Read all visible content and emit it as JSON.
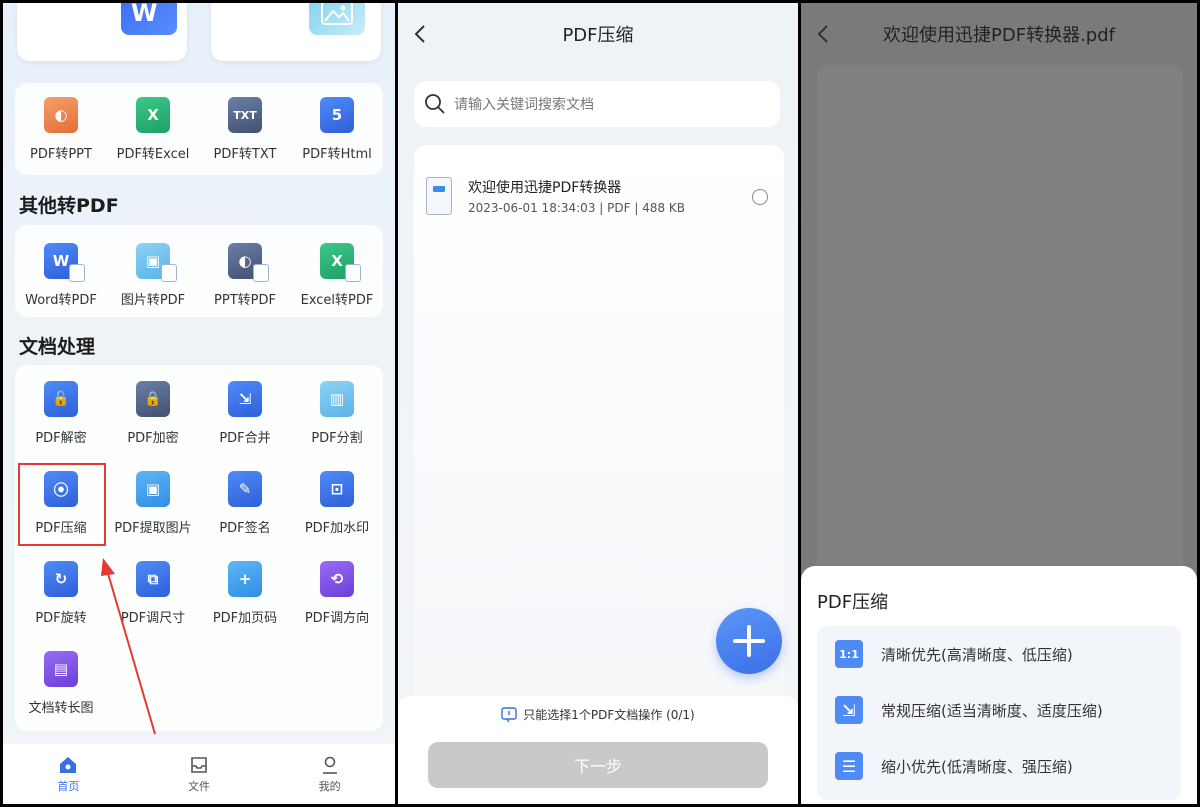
{
  "panel1": {
    "top_cards": [
      {
        "icon": "word-icon",
        "glyph": "W"
      },
      {
        "icon": "image-icon"
      }
    ],
    "pdf_convert_row": [
      {
        "label": "PDF转PPT",
        "icon": "ppt-icon",
        "glyph": "◐"
      },
      {
        "label": "PDF转Excel",
        "icon": "excel-icon",
        "glyph": "X"
      },
      {
        "label": "PDF转TXT",
        "icon": "txt-icon",
        "glyph": "TXT"
      },
      {
        "label": "PDF转Html",
        "icon": "html-icon",
        "glyph": "5"
      }
    ],
    "section_other": "其他转PDF",
    "other_row": [
      {
        "label": "Word转PDF",
        "icon": "word-icon",
        "glyph": "W"
      },
      {
        "label": "图片转PDF",
        "icon": "image-icon",
        "glyph": "▣"
      },
      {
        "label": "PPT转PDF",
        "icon": "ppt-icon",
        "glyph": "◐"
      },
      {
        "label": "Excel转PDF",
        "icon": "excel-icon",
        "glyph": "X"
      }
    ],
    "section_doc": "文档处理",
    "doc_items": [
      {
        "label": "PDF解密",
        "icon": "unlock-icon",
        "glyph": "🔓"
      },
      {
        "label": "PDF加密",
        "icon": "lock-icon",
        "glyph": "🔒"
      },
      {
        "label": "PDF合并",
        "icon": "merge-icon",
        "glyph": "⇲"
      },
      {
        "label": "PDF分割",
        "icon": "split-icon",
        "glyph": "▥"
      },
      {
        "label": "PDF压缩",
        "icon": "compress-icon",
        "glyph": "⦿"
      },
      {
        "label": "PDF提取图片",
        "icon": "extract-image-icon",
        "glyph": "▣"
      },
      {
        "label": "PDF签名",
        "icon": "signature-icon",
        "glyph": "✎"
      },
      {
        "label": "PDF加水印",
        "icon": "watermark-icon",
        "glyph": "⊡"
      },
      {
        "label": "PDF旋转",
        "icon": "rotate-icon",
        "glyph": "↻"
      },
      {
        "label": "PDF调尺寸",
        "icon": "resize-icon",
        "glyph": "⧉"
      },
      {
        "label": "PDF加页码",
        "icon": "page-number-icon",
        "glyph": "+"
      },
      {
        "label": "PDF调方向",
        "icon": "orientation-icon",
        "glyph": "⟲"
      },
      {
        "label": "文档转长图",
        "icon": "long-image-icon",
        "glyph": "▤"
      }
    ],
    "nav": [
      {
        "label": "首页",
        "icon": "home-icon"
      },
      {
        "label": "文件",
        "icon": "inbox-icon"
      },
      {
        "label": "我的",
        "icon": "profile-icon"
      }
    ],
    "accent": "#3a6ee8",
    "highlight_color": "#e53935"
  },
  "panel2": {
    "title": "PDF压缩",
    "search_placeholder": "请输入关键词搜索文档",
    "file": {
      "name": "欢迎使用迅捷PDF转换器",
      "meta": "2023-06-01 18:34:03    | PDF | 488 KB"
    },
    "hint": "只能选择1个PDF文档操作 (0/1)",
    "next_button": "下一步"
  },
  "panel3": {
    "title": "欢迎使用迅捷PDF转换器.pdf",
    "sheet_title": "PDF压缩",
    "options": [
      {
        "label": "清晰优先(高清晰度、低压缩)",
        "icon": "ratio-icon",
        "glyph": "1:1"
      },
      {
        "label": "常规压缩(适当清晰度、适度压缩)",
        "icon": "compress-arrows-icon",
        "glyph": "⇲"
      },
      {
        "label": "缩小优先(低清晰度、强压缩)",
        "icon": "scroll-icon",
        "glyph": "☰"
      }
    ]
  }
}
